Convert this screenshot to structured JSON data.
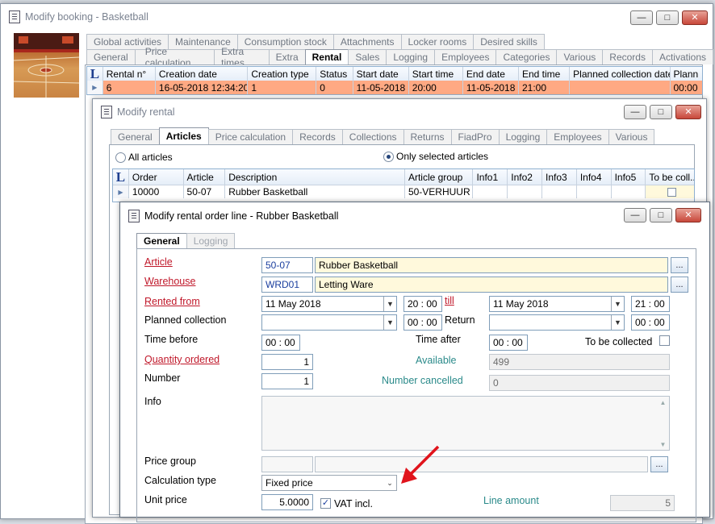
{
  "booking": {
    "title": "Modify booking - Basketball",
    "tabs_row1": [
      "Global activities",
      "Maintenance",
      "Consumption stock",
      "Attachments",
      "Locker rooms",
      "Desired skills"
    ],
    "tabs_row2": [
      "General",
      "Price calculation",
      "Extra times",
      "Extra",
      "Rental",
      "Sales",
      "Logging",
      "Employees",
      "Categories",
      "Various",
      "Records",
      "Activations"
    ],
    "active_tab": "Rental",
    "grid": {
      "headers": [
        "Rental n°",
        "Creation date",
        "Creation type",
        "Status",
        "Start date",
        "Start time",
        "End date",
        "End time",
        "Planned collection date",
        "Plann"
      ],
      "row": [
        "6",
        "16-05-2018 12:34:20",
        "1",
        "0",
        "11-05-2018",
        "20:00",
        "11-05-2018",
        "21:00",
        "",
        "00:00"
      ]
    }
  },
  "rental": {
    "title": "Modify rental",
    "tabs": [
      "General",
      "Articles",
      "Price calculation",
      "Records",
      "Collections",
      "Returns",
      "FiadPro",
      "Logging",
      "Employees",
      "Various"
    ],
    "active_tab": "Articles",
    "radio_all": "All articles",
    "radio_selected": "Only selected articles",
    "grid": {
      "headers": [
        "Order",
        "Article",
        "Description",
        "Article group",
        "Info1",
        "Info2",
        "Info3",
        "Info4",
        "Info5",
        "To be coll..."
      ],
      "row": [
        "10000",
        "50-07",
        "Rubber Basketball",
        "50-VERHUUR",
        "",
        "",
        "",
        "",
        "",
        ""
      ]
    }
  },
  "orderline": {
    "title": "Modify rental order line - Rubber Basketball",
    "tabs": [
      "General",
      "Logging"
    ],
    "active_tab": "General",
    "labels": {
      "article": "Article",
      "warehouse": "Warehouse",
      "rented_from": "Rented from",
      "till": "till",
      "planned_collection": "Planned collection",
      "return": "Return",
      "time_before": "Time before",
      "time_after": "Time after",
      "to_be_collected": "To be collected",
      "quantity_ordered": "Quantity ordered",
      "available": "Available",
      "number": "Number",
      "number_cancelled": "Number cancelled",
      "info": "Info",
      "price_group": "Price group",
      "calculation_type": "Calculation type",
      "unit_price": "Unit price",
      "vat_incl": "VAT incl.",
      "line_amount": "Line amount"
    },
    "values": {
      "article_code": "50-07",
      "article_name": "Rubber Basketball",
      "warehouse_code": "WRD01",
      "warehouse_name": "Letting Ware",
      "rented_from_date": "11 May 2018",
      "rented_from_time": "20 : 00",
      "till_date": "11 May 2018",
      "till_time": "21 : 00",
      "planned_collection_date": "",
      "planned_collection_time": "00 : 00",
      "return_date": "",
      "return_time": "00 : 00",
      "time_before": "00 : 00",
      "time_after": "00 : 00",
      "quantity_ordered": "1",
      "available": "499",
      "number": "1",
      "number_cancelled": "0",
      "info": "",
      "price_group_code": "",
      "price_group_name": "",
      "calculation_type": "Fixed price",
      "unit_price": "5.0000",
      "line_amount": "5"
    },
    "checks": {
      "to_be_collected": false,
      "vat_incl": true
    }
  },
  "colors": {
    "selected_row": "#ffa983",
    "field_blue_text": "#1a3e9e",
    "required_label": "#c0182a",
    "teal_label": "#2a8a8a",
    "arrow": "#e0141c"
  }
}
